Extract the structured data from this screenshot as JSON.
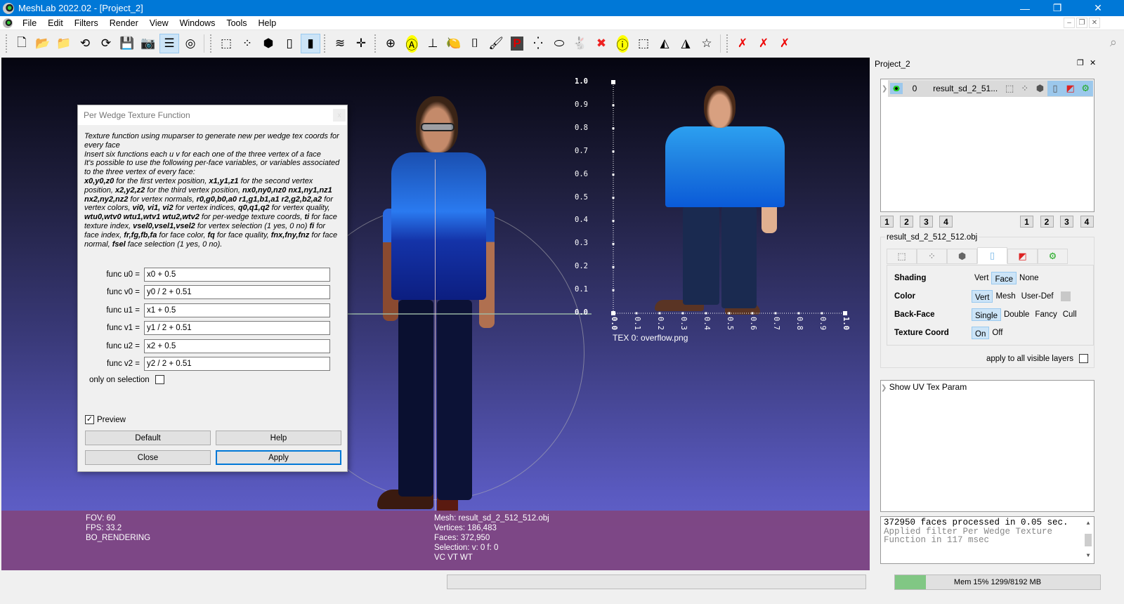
{
  "window": {
    "title": "MeshLab 2022.02 - [Project_2]",
    "minimize_icon": "—",
    "maximize_icon": "❐",
    "close_icon": "✕"
  },
  "menu": {
    "items": [
      "File",
      "Edit",
      "Filters",
      "Render",
      "View",
      "Windows",
      "Tools",
      "Help"
    ],
    "mdi_controls": [
      "–",
      "❐",
      "✕"
    ]
  },
  "toolbar": {
    "groups": [
      [
        {
          "name": "new-project",
          "glyph": "🗋",
          "active": false
        },
        {
          "name": "open-project",
          "glyph": "📂",
          "active": false
        },
        {
          "name": "import-mesh",
          "glyph": "📁",
          "active": false
        },
        {
          "name": "reload",
          "glyph": "⟲",
          "active": false
        },
        {
          "name": "reload-all",
          "glyph": "⟳",
          "active": false
        },
        {
          "name": "export-mesh",
          "glyph": "💾",
          "active": false
        },
        {
          "name": "snapshot",
          "glyph": "📷",
          "active": false
        },
        {
          "name": "show-layer-dialog",
          "glyph": "☰",
          "active": true
        },
        {
          "name": "show-raster",
          "glyph": "◎",
          "active": false
        }
      ],
      [
        {
          "name": "render-bbox",
          "glyph": "⬚",
          "active": false
        },
        {
          "name": "render-points",
          "glyph": "⁘",
          "active": false
        },
        {
          "name": "render-wireframe",
          "glyph": "⬢",
          "active": false
        },
        {
          "name": "render-flat",
          "glyph": "▯",
          "active": false
        },
        {
          "name": "render-smooth",
          "glyph": "▮",
          "active": true
        }
      ],
      [
        {
          "name": "layers",
          "glyph": "≋",
          "active": false
        },
        {
          "name": "axis",
          "glyph": "✛",
          "active": false
        }
      ],
      [
        {
          "name": "trackball",
          "glyph": "⊕",
          "active": false
        },
        {
          "name": "align",
          "glyph": "Ⓐ",
          "active": false
        },
        {
          "name": "reference-frame",
          "glyph": "⊥",
          "active": false
        },
        {
          "name": "measure",
          "glyph": "🍋",
          "active": false
        },
        {
          "name": "raster-align",
          "glyph": "⌷",
          "active": false
        },
        {
          "name": "paint",
          "glyph": "🖌",
          "active": false
        },
        {
          "name": "pick-points",
          "glyph": "P",
          "active": false
        },
        {
          "name": "select-vertex-cluster",
          "glyph": "⁛",
          "active": false
        },
        {
          "name": "select-connected",
          "glyph": "⬭",
          "active": false
        },
        {
          "name": "quality-mapper",
          "glyph": "🐇",
          "active": false
        },
        {
          "name": "georef",
          "glyph": "✖",
          "active": false
        },
        {
          "name": "get-info",
          "glyph": "ⓘ",
          "active": false
        },
        {
          "name": "select-vertices",
          "glyph": "⬚",
          "active": false
        },
        {
          "name": "select-faces",
          "glyph": "◭",
          "active": false
        },
        {
          "name": "select-faces-vertices",
          "glyph": "◮",
          "active": false
        },
        {
          "name": "select-by-polyline",
          "glyph": "☆",
          "active": false
        }
      ],
      [
        {
          "name": "delete-vertices",
          "glyph": "✗",
          "active": false
        },
        {
          "name": "delete-faces",
          "glyph": "✗",
          "active": false
        },
        {
          "name": "delete-faces-vertices",
          "glyph": "✗",
          "active": false
        }
      ]
    ],
    "search_icon": "⌕"
  },
  "viewport": {
    "info_left": [
      "FOV: 60",
      "FPS:    33.2",
      "BO_RENDERING"
    ],
    "info_right": [
      "Mesh: result_sd_2_512_512.obj",
      "Vertices: 186,483",
      "Faces: 372,950",
      "Selection: v: 0 f: 0",
      "VC VT WT"
    ],
    "uv_plot": {
      "y_ticks": [
        "1.0",
        "0.9",
        "0.8",
        "0.7",
        "0.6",
        "0.5",
        "0.4",
        "0.3",
        "0.2",
        "0.1",
        "0.0"
      ],
      "x_ticks": [
        "0.0",
        "0.1",
        "0.2",
        "0.3",
        "0.4",
        "0.5",
        "0.6",
        "0.7",
        "0.8",
        "0.9",
        "1.0"
      ],
      "texture_label": "TEX 0: overflow.png"
    }
  },
  "dialog": {
    "title": "Per Wedge Texture Function",
    "close_icon": "x",
    "description_html": "Texture function using muparser to generate new per wedge tex coords for every face<br>Insert six functions each u v for each one of the three vertex of a face<br>It's possible to use the following per-face variables, or variables associated to the three vertex of every face:<br><b>x0,y0,z0</b> for the first vertex position, <b>x1,y1,z1</b> for the second vertex position, <b>x2,y2,z2</b> for the third vertex position, <b>nx0,ny0,nz0 nx1,ny1,nz1 nx2,ny2,nz2</b> for vertex normals, <b>r0,g0,b0,a0 r1,g1,b1,a1 r2,g2,b2,a2</b> for vertex colors, <b>vi0, vi1, vi2</b> for vertex indices, <b>q0,q1,q2</b> for vertex quality, <b>wtu0,wtv0 wtu1,wtv1 wtu2,wtv2</b> for per-wedge texture coords, <b>ti</b> for face texture index, <b>vsel0,vsel1,vsel2</b> for vertex selection (1 yes, 0 no) <b>fi</b> for face index, <b>fr,fg,fb,fa</b> for face color, <b>fq</b> for face quality, <b>fnx,fny,fnz</b> for face normal, <b>fsel</b> face selection (1 yes, 0 no).",
    "functions": [
      {
        "label": "func u0 =",
        "value": "x0 + 0.5"
      },
      {
        "label": "func v0 =",
        "value": "y0 / 2 + 0.51"
      },
      {
        "label": "func u1 =",
        "value": "x1 + 0.5"
      },
      {
        "label": "func v1 =",
        "value": "y1 / 2 + 0.51"
      },
      {
        "label": "func u2 =",
        "value": "x2 + 0.5"
      },
      {
        "label": "func v2 =",
        "value": "y2 / 2 + 0.51"
      }
    ],
    "only_on_selection": {
      "label": "only on selection",
      "checked": false
    },
    "preview": {
      "label": "Preview",
      "checked": true
    },
    "buttons": {
      "default": "Default",
      "help": "Help",
      "close": "Close",
      "apply": "Apply"
    }
  },
  "right_panel": {
    "title": "Project_2",
    "float_icon": "❐",
    "close_icon": "✕",
    "layer": {
      "index": "0",
      "name": "result_sd_2_51...",
      "visible": true
    },
    "layer_tools": [
      {
        "name": "bbox",
        "glyph": "⬚",
        "active": false
      },
      {
        "name": "points",
        "glyph": "⁘",
        "active": false
      },
      {
        "name": "wireframe",
        "glyph": "⬢",
        "active": false
      },
      {
        "name": "fill",
        "glyph": "▯",
        "active": true
      },
      {
        "name": "texture",
        "glyph": "◩",
        "active": true
      },
      {
        "name": "options",
        "glyph": "⚙",
        "active": true
      }
    ],
    "left_num_buttons": [
      "1",
      "2",
      "3",
      "4"
    ],
    "right_num_buttons": [
      "1",
      "2",
      "3",
      "4"
    ],
    "render_group_title": "result_sd_2_512_512.obj",
    "render_tabs": [
      {
        "name": "bbox",
        "glyph": "⬚",
        "active": false
      },
      {
        "name": "points",
        "glyph": "⁘",
        "active": false
      },
      {
        "name": "wireframe",
        "glyph": "⬢",
        "active": false
      },
      {
        "name": "fill",
        "glyph": "▯",
        "active": true
      },
      {
        "name": "texture",
        "glyph": "◩",
        "active": false
      },
      {
        "name": "options",
        "glyph": "⚙",
        "active": false
      }
    ],
    "options": [
      {
        "label": "Shading",
        "choices": [
          "Vert",
          "Face",
          "None"
        ],
        "selected": "Face"
      },
      {
        "label": "Color",
        "choices": [
          "Vert",
          "Mesh",
          "User-Def"
        ],
        "selected": "Vert",
        "swatch": "#c8c8c8"
      },
      {
        "label": "Back-Face",
        "choices": [
          "Single",
          "Double",
          "Fancy",
          "Cull"
        ],
        "selected": "Single"
      },
      {
        "label": "Texture Coord",
        "choices": [
          "On",
          "Off"
        ],
        "selected": "On"
      }
    ],
    "apply_all": {
      "label": "apply to all visible layers",
      "checked": false
    },
    "uv_param": {
      "label": "Show UV Tex Param"
    },
    "log": {
      "line1": "372950 faces processed in 0.05 sec.",
      "line2": "Applied filter Per Wedge Texture Function in 117 msec"
    }
  },
  "statusbar": {
    "memory": {
      "text": "Mem 15% 1299/8192 MB",
      "percent": 15
    }
  }
}
